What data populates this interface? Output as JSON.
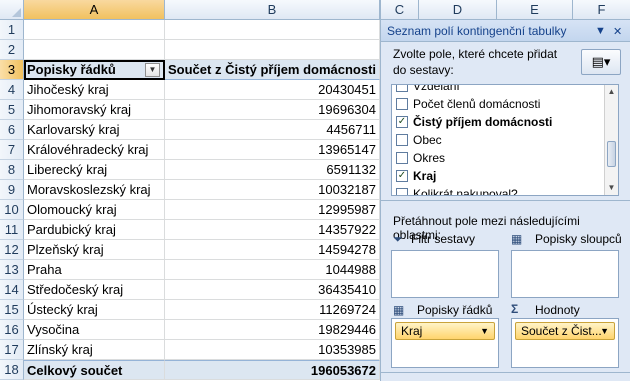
{
  "sheet": {
    "columns": [
      "A",
      "B"
    ],
    "selected_column": "A",
    "selected_row": "3",
    "blank_rows": [
      {
        "num": "1",
        "a": "",
        "b": ""
      },
      {
        "num": "2",
        "a": "",
        "b": ""
      }
    ],
    "header_row": {
      "num": "3",
      "a": "Popisky řádků",
      "b": "Součet z Čistý příjem domácnosti"
    },
    "rows": [
      {
        "num": "4",
        "a": "Jihočeský kraj",
        "b": "20430451"
      },
      {
        "num": "5",
        "a": "Jihomoravský kraj",
        "b": "19696304"
      },
      {
        "num": "6",
        "a": "Karlovarský kraj",
        "b": "4456711"
      },
      {
        "num": "7",
        "a": "Královéhradecký kraj",
        "b": "13965147"
      },
      {
        "num": "8",
        "a": "Liberecký kraj",
        "b": "6591132"
      },
      {
        "num": "9",
        "a": "Moravskoslezský kraj",
        "b": "10032187"
      },
      {
        "num": "10",
        "a": "Olomoucký kraj",
        "b": "12995987"
      },
      {
        "num": "11",
        "a": "Pardubický kraj",
        "b": "14357922"
      },
      {
        "num": "12",
        "a": "Plzeňský kraj",
        "b": "14594278"
      },
      {
        "num": "13",
        "a": "Praha",
        "b": "1044988"
      },
      {
        "num": "14",
        "a": "Středočeský kraj",
        "b": "36435410"
      },
      {
        "num": "15",
        "a": "Ústecký kraj",
        "b": "11269724"
      },
      {
        "num": "16",
        "a": "Vysočina",
        "b": "19829446"
      },
      {
        "num": "17",
        "a": "Zlínský kraj",
        "b": "10353985"
      }
    ],
    "total_row": {
      "num": "18",
      "a": "Celkový součet",
      "b": "196053672"
    }
  },
  "pane": {
    "columns": [
      "C",
      "D",
      "E",
      "F"
    ],
    "title": "Seznam polí kontingenční tabulky",
    "instruction": "Zvolte pole, které chcete přidat do sestavy:",
    "fields": [
      {
        "label": "Vzdělání",
        "checked": false,
        "bold": false
      },
      {
        "label": "Počet členů domácnosti",
        "checked": false,
        "bold": false
      },
      {
        "label": "Čistý příjem domácnosti",
        "checked": true,
        "bold": true
      },
      {
        "label": "Obec",
        "checked": false,
        "bold": false
      },
      {
        "label": "Okres",
        "checked": false,
        "bold": false
      },
      {
        "label": "Kraj",
        "checked": true,
        "bold": true
      },
      {
        "label": "Kolikrát nakupoval?",
        "checked": false,
        "bold": false
      }
    ],
    "drag_label": "Přetáhnout pole mezi následujícími oblastmi:",
    "zones": {
      "filter": {
        "label": "Filtr sestavy",
        "icon": "filter-icon"
      },
      "columns": {
        "label": "Popisky sloupců",
        "icon": "column-labels-icon"
      },
      "rows": {
        "label": "Popisky řádků",
        "icon": "row-labels-icon",
        "chip": "Kraj"
      },
      "values": {
        "label": "Hodnoty",
        "icon": "sigma-icon",
        "chip": "Součet z Čist..."
      }
    }
  }
}
